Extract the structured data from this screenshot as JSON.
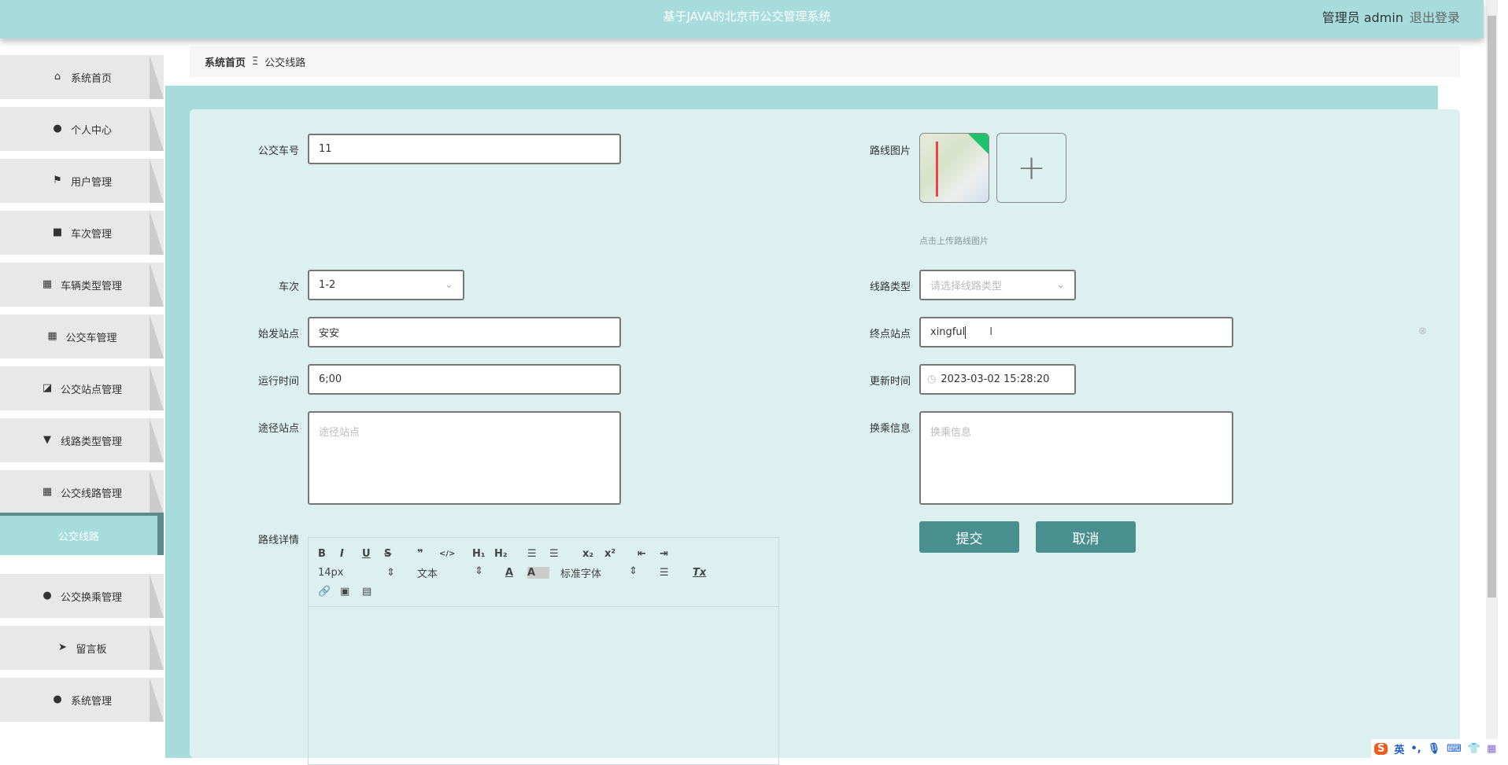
{
  "header": {
    "title": "基于JAVA的北京市公交管理系统",
    "user": "管理员 admin",
    "logout": "退出登录"
  },
  "sidebar": {
    "items": [
      {
        "label": "系统首页",
        "icon": "home-icon",
        "glyph": "⌂"
      },
      {
        "label": "个人中心",
        "icon": "user-icon",
        "glyph": "●"
      },
      {
        "label": "用户管理",
        "icon": "flag-icon",
        "glyph": "⚑"
      },
      {
        "label": "车次管理",
        "icon": "briefcase-icon",
        "glyph": "■"
      },
      {
        "label": "车辆类型管理",
        "icon": "grid-icon",
        "glyph": "▦"
      },
      {
        "label": "公交车管理",
        "icon": "grid-icon",
        "glyph": "▦"
      },
      {
        "label": "公交站点管理",
        "icon": "chart-icon",
        "glyph": "◪"
      },
      {
        "label": "线路类型管理",
        "icon": "brush-icon",
        "glyph": "▼"
      },
      {
        "label": "公交线路管理",
        "icon": "grid-icon",
        "glyph": "▦"
      },
      {
        "label": "公交线路",
        "icon": "",
        "glyph": ""
      },
      {
        "label": "公交换乘管理",
        "icon": "bulb-icon",
        "glyph": "●"
      },
      {
        "label": "留言板",
        "icon": "send-icon",
        "glyph": "➤"
      },
      {
        "label": "系统管理",
        "icon": "admin-icon",
        "glyph": "●"
      }
    ]
  },
  "breadcrumb": {
    "home": "系统首页",
    "sep": "Ξ",
    "current": "公交线路"
  },
  "form": {
    "bus_no": {
      "label": "公交车号",
      "value": "11"
    },
    "route_image": {
      "label": "路线图片",
      "hint": "点击上传路线图片"
    },
    "trip": {
      "label": "车次",
      "value": "1-2"
    },
    "route_type": {
      "label": "线路类型",
      "placeholder": "请选择线路类型"
    },
    "start": {
      "label": "始发站点",
      "value": "安安"
    },
    "end": {
      "label": "终点站点",
      "value": "xingful"
    },
    "run_time": {
      "label": "运行时间",
      "value": "6;00"
    },
    "update_time": {
      "label": "更新时间",
      "value": "2023-03-02 15:28:20"
    },
    "via": {
      "label": "途径站点",
      "placeholder": "途径站点"
    },
    "transfer": {
      "label": "换乘信息",
      "placeholder": "换乘信息"
    },
    "detail": {
      "label": "路线详情"
    },
    "submit": "提交",
    "cancel": "取消"
  },
  "editor": {
    "size": "14px",
    "header": "文本",
    "font": "标准字体"
  },
  "ime": {
    "lang": "英"
  }
}
